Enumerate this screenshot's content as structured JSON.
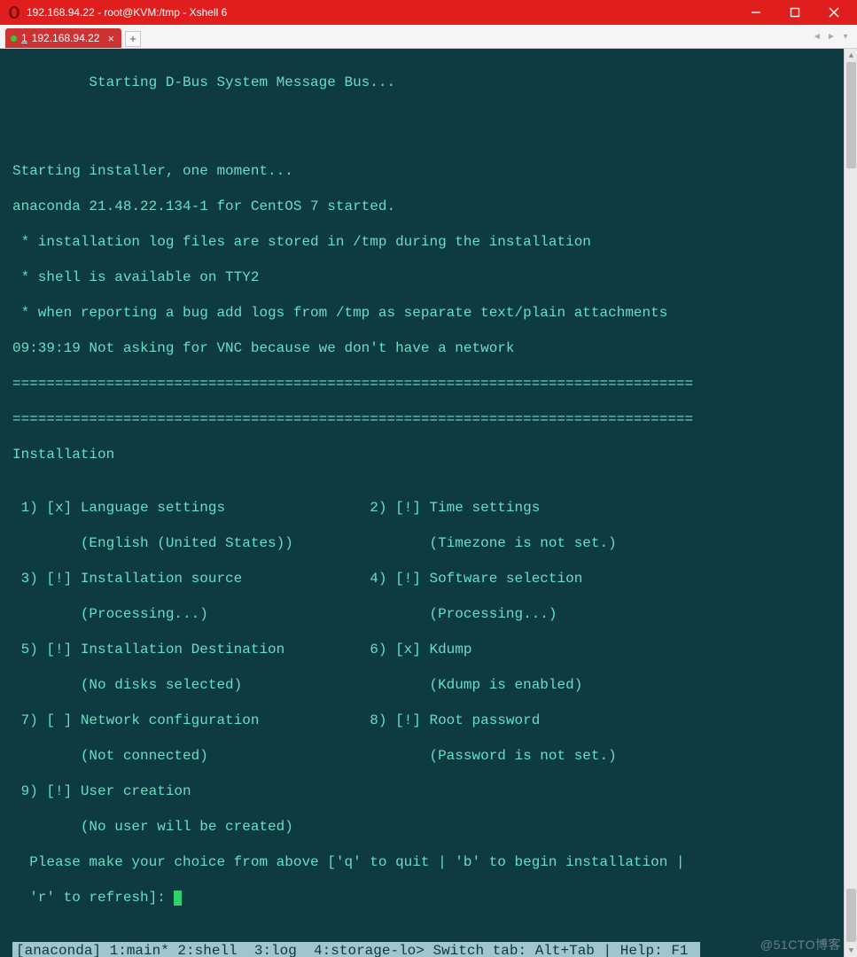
{
  "window": {
    "title": "192.168.94.22 - root@KVM:/tmp - Xshell 6"
  },
  "tab": {
    "index": "1",
    "label": "192.168.94.22"
  },
  "addtab_label": "+",
  "terminal": {
    "boot_line": "         Starting D-Bus System Message Bus...",
    "blank": "",
    "pre1": "Starting installer, one moment...",
    "pre2": "anaconda 21.48.22.134-1 for CentOS 7 started.",
    "pre3": " * installation log files are stored in /tmp during the installation",
    "pre4": " * shell is available on TTY2",
    "pre5": " * when reporting a bug add logs from /tmp as separate text/plain attachments",
    "pre6": "09:39:19 Not asking for VNC because we don't have a network",
    "rule": "================================================================================",
    "rule2": "================================================================================",
    "section": "Installation",
    "menu": [
      " 1) [x] Language settings                 2) [!] Time settings",
      "        (English (United States))                (Timezone is not set.)",
      " 3) [!] Installation source               4) [!] Software selection",
      "        (Processing...)                          (Processing...)",
      " 5) [!] Installation Destination          6) [x] Kdump",
      "        (No disks selected)                      (Kdump is enabled)",
      " 7) [ ] Network configuration             8) [!] Root password",
      "        (Not connected)                          (Password is not set.)",
      " 9) [!] User creation",
      "        (No user will be created)"
    ],
    "prompt1": "  Please make your choice from above ['q' to quit | 'b' to begin installation |",
    "prompt2": "  'r' to refresh]: ",
    "status": "[anaconda] 1:main* 2:shell  3:log  4:storage-lo> Switch tab: Alt+Tab | Help: F1 "
  },
  "watermark": "@51CTO博客"
}
